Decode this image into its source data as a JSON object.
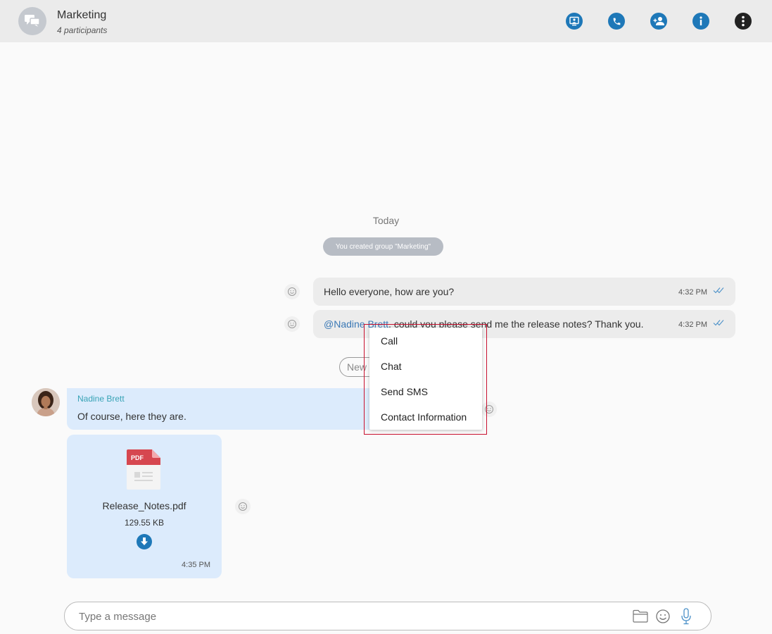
{
  "header": {
    "title": "Marketing",
    "subtitle": "4 participants",
    "actions": [
      "screen-share",
      "call",
      "add-participant",
      "info",
      "more"
    ]
  },
  "conversation": {
    "date_label": "Today",
    "system_message": "You created group \"Marketing\"",
    "outgoing": [
      {
        "text": "Hello everyone, how are you?",
        "time": "4:32 PM",
        "status": "read"
      },
      {
        "mention": "@Nadine Brett",
        "text": ", could you please send me the release notes? Thank you.",
        "time": "4:32 PM",
        "status": "read"
      }
    ],
    "new_messages_label": "New",
    "incoming": {
      "sender": "Nadine Brett",
      "text": "Of course, here they are.",
      "file": {
        "badge": "PDF",
        "name": "Release_Notes.pdf",
        "size": "129.55 KB",
        "time": "4:35 PM"
      }
    }
  },
  "context_menu": {
    "items": [
      "Call",
      "Chat",
      "Send SMS",
      "Contact Information"
    ]
  },
  "composer": {
    "placeholder": "Type a message"
  },
  "colors": {
    "accent": "#1e78b8",
    "incoming_bubble": "#dcebfc",
    "outgoing_bubble": "#ececec",
    "mention": "#3a78b5",
    "sender_name": "#38a3b6",
    "highlight_border": "#c8102e"
  }
}
